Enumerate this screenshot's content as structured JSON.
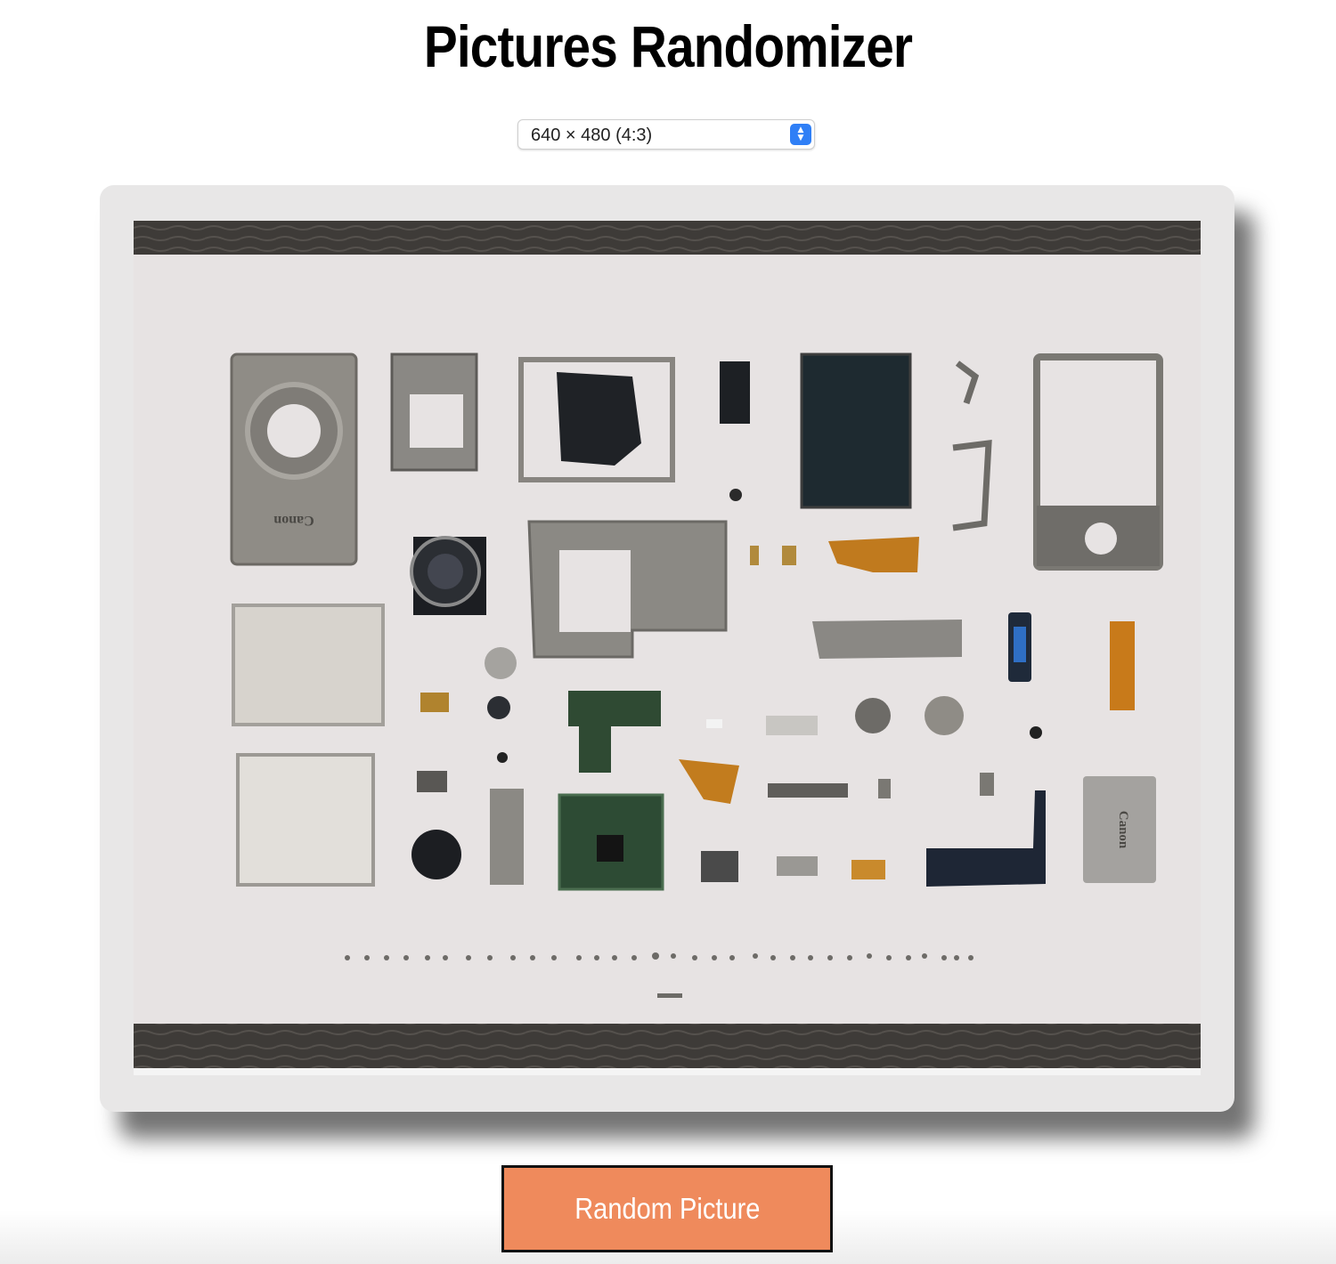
{
  "page": {
    "title": "Pictures Randomizer"
  },
  "size_select": {
    "value": "640 × 480 (4:3)"
  },
  "picture": {
    "subject": "disassembled-camera-parts-flatlay",
    "brand_text": "Canon"
  },
  "actions": {
    "random_label": "Random Picture"
  },
  "colors": {
    "button": "#ef8a5c",
    "frame": "#e8e7e7",
    "select_accent": "#2f7ff6",
    "wood": "#3e3b38"
  }
}
